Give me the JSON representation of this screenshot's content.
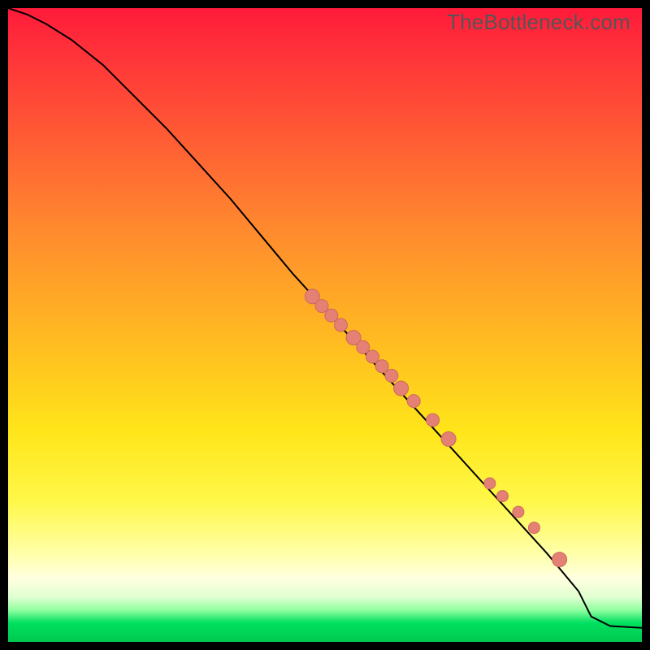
{
  "watermark": "TheBottleneck.com",
  "colors": {
    "dot_fill": "#e58074",
    "dot_stroke": "#c96a5f",
    "curve": "#000000"
  },
  "chart_data": {
    "type": "line",
    "title": "",
    "xlabel": "",
    "ylabel": "",
    "xlim": [
      0,
      100
    ],
    "ylim": [
      0,
      100
    ],
    "grid": false,
    "legend": false,
    "series": [
      {
        "name": "curve",
        "x": [
          0,
          3,
          6,
          10,
          15,
          20,
          25,
          30,
          35,
          40,
          45,
          50,
          55,
          60,
          65,
          70,
          75,
          80,
          85,
          90,
          92,
          95,
          100
        ],
        "y": [
          100,
          99,
          97.5,
          95,
          91,
          86,
          81,
          75.5,
          70,
          64,
          58,
          52.5,
          47,
          41.5,
          36,
          30.5,
          25,
          19.5,
          14,
          8,
          4,
          2.5,
          2.2
        ]
      }
    ],
    "scatter": [
      {
        "name": "markers",
        "points": [
          {
            "x": 48,
            "y": 54.5,
            "r": 9
          },
          {
            "x": 49.5,
            "y": 53,
            "r": 8
          },
          {
            "x": 51,
            "y": 51.5,
            "r": 8
          },
          {
            "x": 52.5,
            "y": 50,
            "r": 8
          },
          {
            "x": 54.5,
            "y": 48,
            "r": 9
          },
          {
            "x": 56,
            "y": 46.5,
            "r": 8
          },
          {
            "x": 57.5,
            "y": 45,
            "r": 8
          },
          {
            "x": 59,
            "y": 43.5,
            "r": 8
          },
          {
            "x": 60.5,
            "y": 42,
            "r": 8
          },
          {
            "x": 62,
            "y": 40,
            "r": 9
          },
          {
            "x": 64,
            "y": 38,
            "r": 8
          },
          {
            "x": 67,
            "y": 35,
            "r": 8
          },
          {
            "x": 69.5,
            "y": 32,
            "r": 9
          },
          {
            "x": 76,
            "y": 25,
            "r": 7
          },
          {
            "x": 78,
            "y": 23,
            "r": 7
          },
          {
            "x": 80.5,
            "y": 20.5,
            "r": 7
          },
          {
            "x": 83,
            "y": 18,
            "r": 7
          },
          {
            "x": 87,
            "y": 13,
            "r": 9
          }
        ]
      }
    ]
  }
}
